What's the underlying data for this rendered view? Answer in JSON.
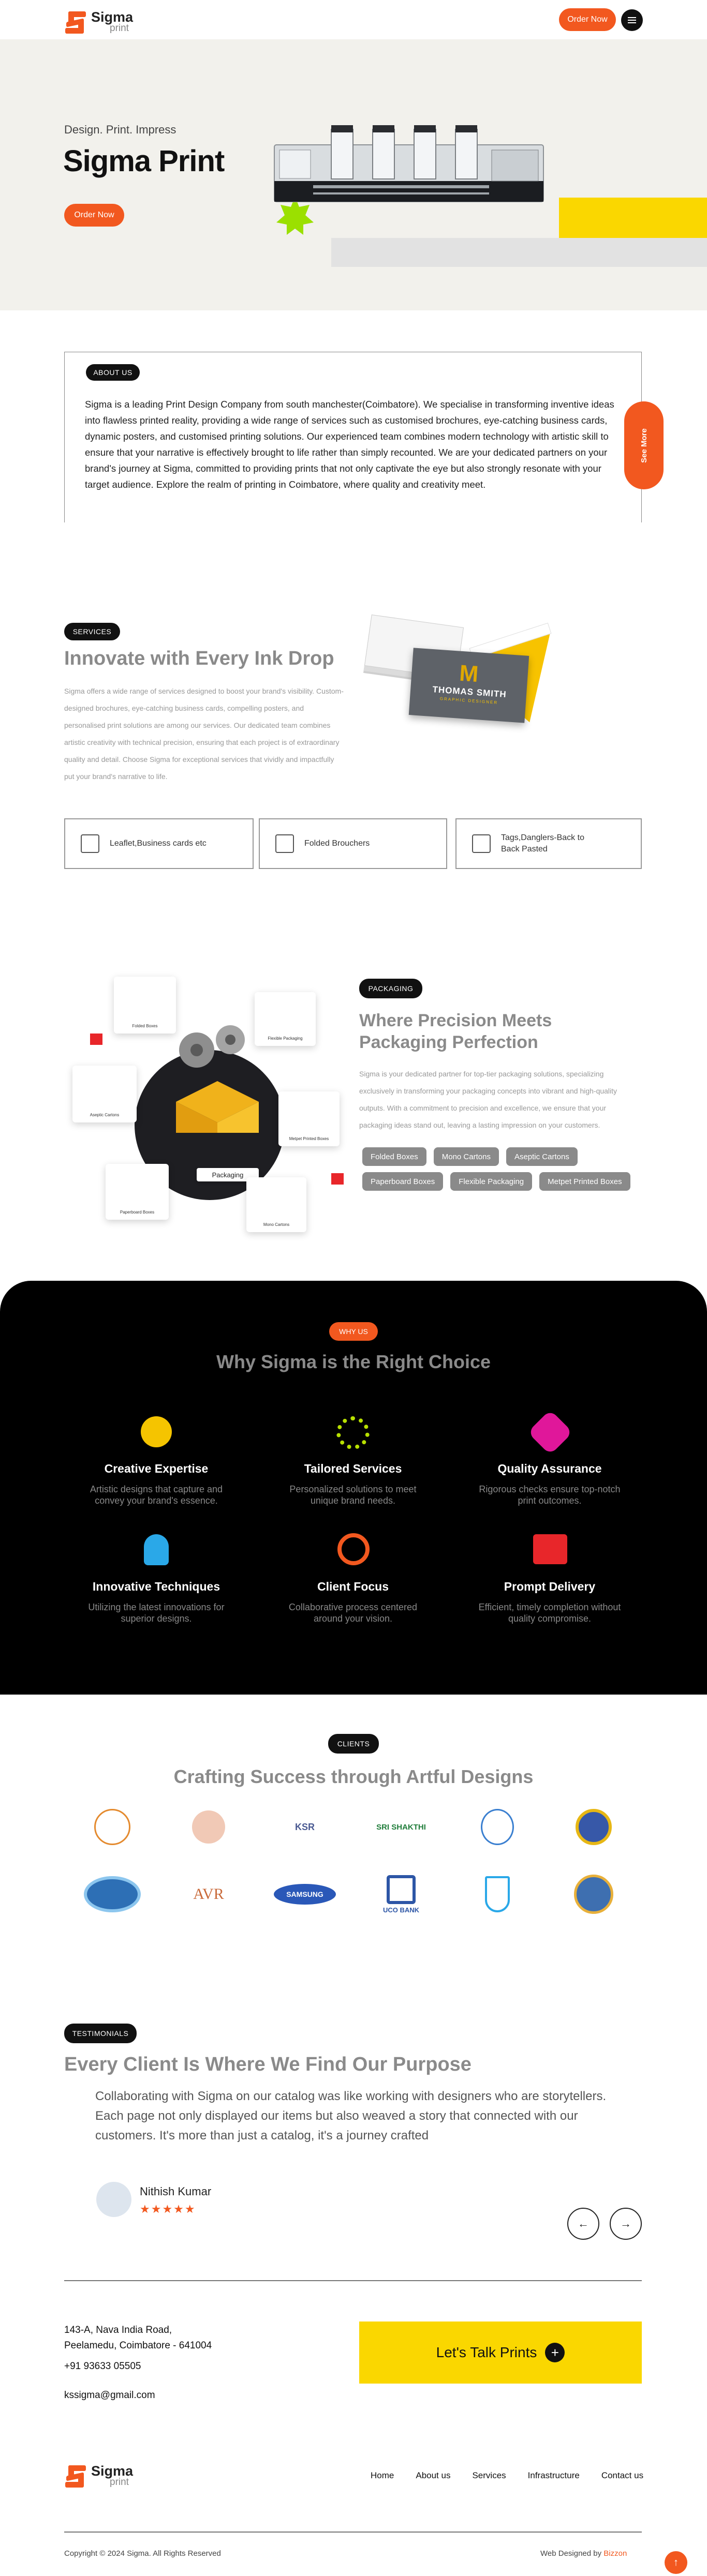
{
  "header": {
    "logo_big": "Sigma",
    "logo_small": "print",
    "order_button": "Order Now"
  },
  "hero": {
    "subtitle": "Design. Print. Impress",
    "title": "Sigma Print",
    "cta": "Order Now"
  },
  "about": {
    "badge": "ABOUT US",
    "text": "Sigma is a leading Print Design Company from south manchester(Coimbatore). We specialise in transforming inventive ideas into flawless printed reality, providing a wide range of services such as customised brochures, eye-catching business cards, dynamic posters, and customised printing solutions. Our experienced team combines modern technology with artistic skill to ensure that your narrative is effectively brought to life rather than simply recounted. We are your dedicated partners on your brand's journey at Sigma, committed to providing prints that not only captivate the eye but also strongly resonate with your target audience. Explore the realm of printing in Coimbatore, where quality and creativity meet.",
    "see_more": "See More"
  },
  "services": {
    "badge": "SERVICES",
    "title": "Innovate with Every Ink Drop",
    "body": "Sigma offers a wide range of services designed to boost your brand's visibility. Custom-designed brochures, eye-catching business cards, compelling posters, and personalised print solutions are among our services. Our dedicated team combines artistic creativity with technical precision, ensuring that each project is of extraordinary quality and detail. Choose Sigma for exceptional services that vividly and impactfully put your brand's narrative to life.",
    "card_name": "THOMAS SMITH",
    "card_sub": "GRAPHIC DESIGNER",
    "cards": [
      {
        "label": "Leaflet,Business cards etc"
      },
      {
        "label": "Folded Brouchers"
      },
      {
        "label": "Tags,Danglers-Back to Back Pasted"
      }
    ]
  },
  "packaging": {
    "badge": "PACKAGING",
    "title_line1": "Where Precision Meets",
    "title_line2": "Packaging Perfection",
    "body": "Sigma is your dedicated partner for top-tier packaging solutions, specializing exclusively in transforming your packaging concepts into vibrant and high-quality outputs. With a commitment to precision and excellence, we ensure that your packaging ideas stand out, leaving a lasting impression on your customers.",
    "tags": [
      "Folded Boxes",
      "Mono Cartons",
      "Aseptic Cartons",
      "Paperboard Boxes",
      "Flexible Packaging",
      "Metpet Printed Boxes"
    ],
    "box_label": "Packaging",
    "items": [
      "Folded Boxes",
      "Flexible Packaging",
      "Aseptic Cartons",
      "Metpet Printed Boxes",
      "Paperboard Boxes",
      "Mono Cartons"
    ]
  },
  "why": {
    "badge": "WHY US",
    "title": "Why Sigma is the Right Choice",
    "items": [
      {
        "title": "Creative Expertise",
        "body": "Artistic designs that capture and convey your brand's essence."
      },
      {
        "title": "Tailored Services",
        "body": "Personalized solutions to meet unique brand needs."
      },
      {
        "title": "Quality Assurance",
        "body": "Rigorous checks ensure top-notch print outcomes."
      },
      {
        "title": "Innovative Techniques",
        "body": "Utilizing the latest innovations for superior designs."
      },
      {
        "title": "Client Focus",
        "body": "Collaborative process centered around your vision."
      },
      {
        "title": "Prompt Delivery",
        "body": "Efficient, timely completion without quality compromise."
      }
    ],
    "colors": {
      "yellow": "#f5c400",
      "lime": "#b7e000",
      "magenta": "#e0179a",
      "blue": "#2aa8e8",
      "orange": "#f2581f",
      "red": "#e8262a"
    }
  },
  "clients": {
    "badge": "CLIENTS",
    "title": "Crafting Success through Artful Designs",
    "logos": [
      "KSR",
      "SRI SHAKTHI",
      "AVR",
      "SAMSUNG",
      "UCO BANK"
    ]
  },
  "testimonials": {
    "badge": "TESTIMONIALS",
    "title": "Every Client Is Where We Find Our Purpose",
    "quote": "Collaborating with Sigma on our catalog was like working with designers who are storytellers. Each page not only displayed our items but also weaved a story that connected with our customers. It's more than just a catalog, it's a journey crafted",
    "name": "Nithish Kumar",
    "stars": "★★★★★",
    "rating": 5
  },
  "contact": {
    "address_line1": "143-A, Nava India Road,",
    "address_line2": "Peelamedu, Coimbatore - 641004",
    "phone": "+91 93633 05505",
    "email": "kssigma@gmail.com",
    "cta": "Let's Talk Prints"
  },
  "footer": {
    "links": [
      "Home",
      "About us",
      "Services",
      "Infrastructure",
      "Contact us"
    ],
    "copyright": "Copyright © 2024 Sigma. All Rights Reserved",
    "designed_by": "Web Designed by",
    "designer": "Bizzon"
  },
  "accent": "#f2581f"
}
